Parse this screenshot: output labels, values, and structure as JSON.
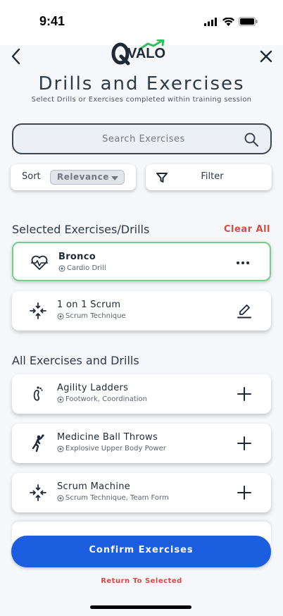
{
  "status": {
    "time": "9:41"
  },
  "header": {
    "logo_text": "VALO",
    "title": "Drills and Exercises",
    "subtitle": "Select Drills or Exercises completed within training session"
  },
  "search": {
    "placeholder": "Search Exercises"
  },
  "sort": {
    "label": "Sort",
    "value": "Relevance"
  },
  "filter": {
    "label": "Filter"
  },
  "selected_section": {
    "heading": "Selected Exercises/Drills",
    "clear_label": "Clear All",
    "items": [
      {
        "title": "Bronco",
        "subtitle": "Cardio Drill",
        "icon": "heart-pulse-icon",
        "action": "more-icon"
      },
      {
        "title": "1 on 1 Scrum",
        "subtitle": "Scrum Technique",
        "icon": "arrows-in-icon",
        "action": "edit-icon"
      }
    ]
  },
  "all_section": {
    "heading": "All Exercises and Drills",
    "items": [
      {
        "title": "Agility Ladders",
        "subtitle": "Footwork, Coordination",
        "icon": "footprint-icon",
        "action": "add-icon"
      },
      {
        "title": "Medicine Ball Throws",
        "subtitle": "Explosive Upper Body Power",
        "icon": "throw-icon",
        "action": "add-icon"
      },
      {
        "title": "Scrum Machine",
        "subtitle": "Scrum Technique, Team Form",
        "icon": "arrows-in-icon",
        "action": "add-icon"
      }
    ]
  },
  "footer": {
    "confirm_label": "Confirm Exercises",
    "return_label": "Return To Selected"
  },
  "colors": {
    "accent": "#1d5de0",
    "danger": "#d9493f",
    "selected_border": "#6fd185",
    "logo_arrow": "#2fc25a"
  }
}
